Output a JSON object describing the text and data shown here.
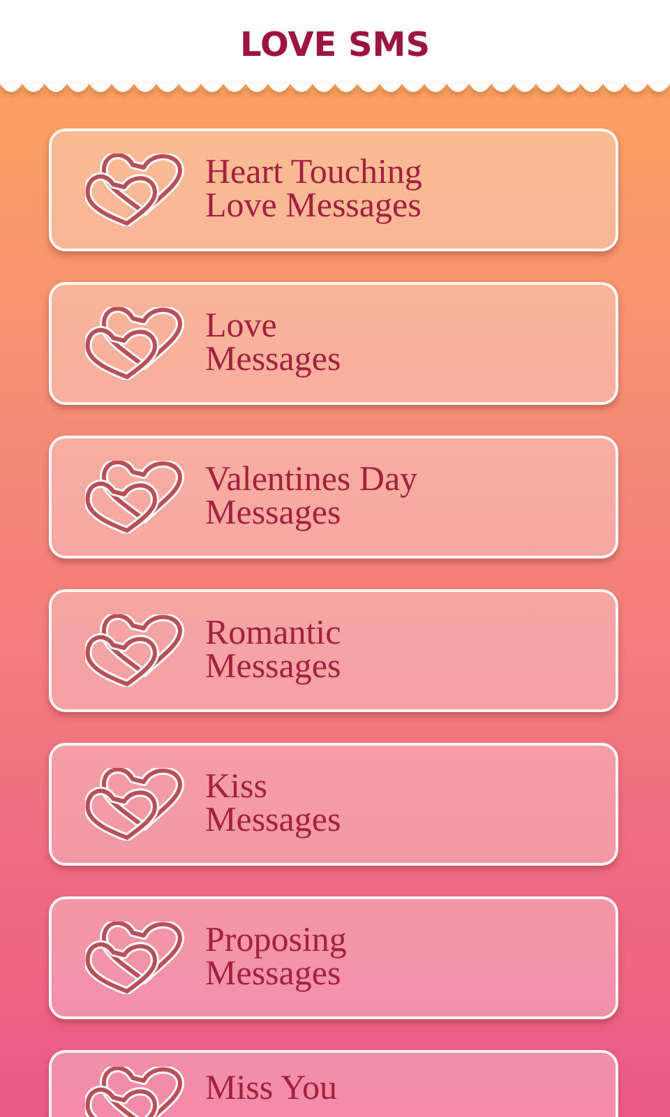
{
  "title": "LOVE SMS",
  "categories": [
    {
      "lines": [
        "Heart Touching",
        "Love Messages"
      ]
    },
    {
      "lines": [
        "Love",
        "Messages"
      ]
    },
    {
      "lines": [
        "Valentines Day",
        "Messages"
      ]
    },
    {
      "lines": [
        "Romantic",
        "Messages"
      ]
    },
    {
      "lines": [
        "Kiss",
        "Messages"
      ]
    },
    {
      "lines": [
        "Proposing",
        "Messages"
      ]
    },
    {
      "lines": [
        "Miss You"
      ]
    }
  ]
}
